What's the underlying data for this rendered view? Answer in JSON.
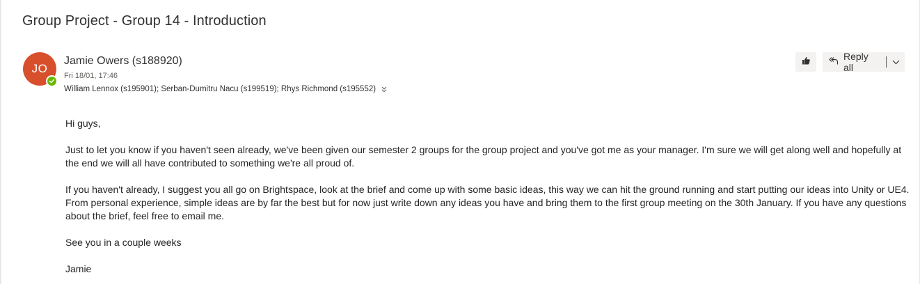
{
  "message": {
    "subject": "Group Project - Group 14 - Introduction",
    "sender": {
      "initials": "JO",
      "name": "Jamie Owers (s188920)",
      "avatar_color": "#d84f2c",
      "presence": "available"
    },
    "datetime": "Fri 18/01, 17:46",
    "recipients": "William Lennox (s195901); Serban-Dumitru Nacu (s199519); Rhys Richmond (s195552)",
    "actions": {
      "like_icon": "thumbs-up-icon",
      "reply_all_label": "Reply all",
      "reply_all_icon": "reply-all-icon",
      "more_icon": "chevron-down-icon"
    },
    "body": [
      "Hi guys,",
      "Just to let you know if you haven't seen already, we've been given our semester 2 groups for the group project and you've got me as your manager. I'm sure we will get along well and hopefully at the end we will all have contributed to something we're all proud of.",
      "If you haven't already, I suggest you all go on Brightspace, look at the brief and come up with some basic ideas, this way we can hit the ground running and start putting our ideas into Unity or UE4. From personal experience, simple ideas are by far the best but for now just write down any ideas you have and bring them to the first group meeting on the 30th January. If you have any questions about the brief, feel free to email me.",
      "See you in a couple weeks",
      "Jamie"
    ]
  }
}
